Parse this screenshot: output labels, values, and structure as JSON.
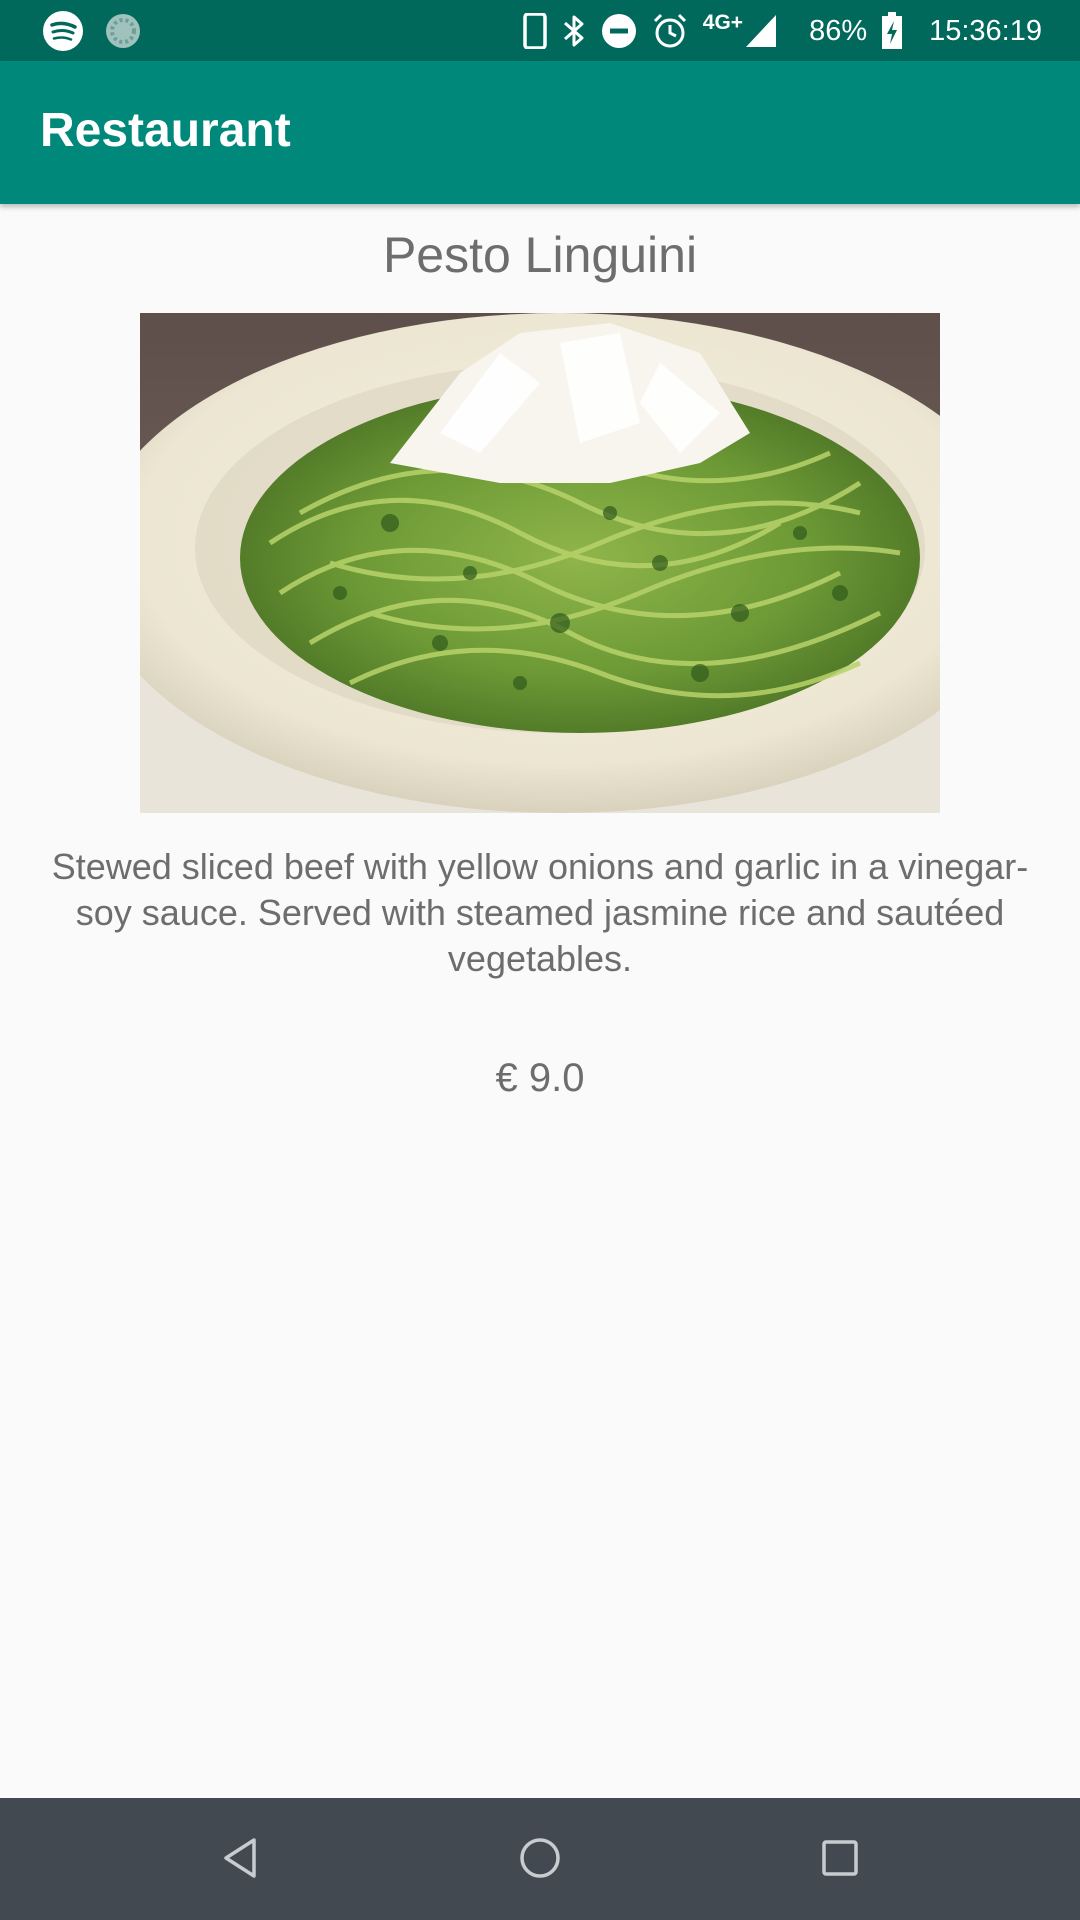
{
  "status_bar": {
    "left_icons": [
      "spotify-icon",
      "sync-icon"
    ],
    "right_icons": [
      "phone-icon",
      "bluetooth-icon",
      "do-not-disturb-icon",
      "alarm-icon",
      "signal-icon",
      "battery-charging-icon"
    ],
    "network": "4G+",
    "battery": "86%",
    "time": "15:36:19"
  },
  "app_bar": {
    "title": "Restaurant"
  },
  "dish": {
    "name": "Pesto Linguini",
    "description": "Stewed sliced beef with yellow onions and garlic in a vinegar-soy sauce. Served with steamed jasmine rice and sautéed vegetables.",
    "price": "€ 9.0"
  },
  "nav_bar": {
    "icons": [
      "back-icon",
      "home-icon",
      "recents-icon"
    ]
  },
  "colors": {
    "status_bar": "#00695c",
    "app_bar": "#00897b",
    "background": "#fafafa",
    "text": "#6d6d6d",
    "nav_bar": "#434950"
  }
}
